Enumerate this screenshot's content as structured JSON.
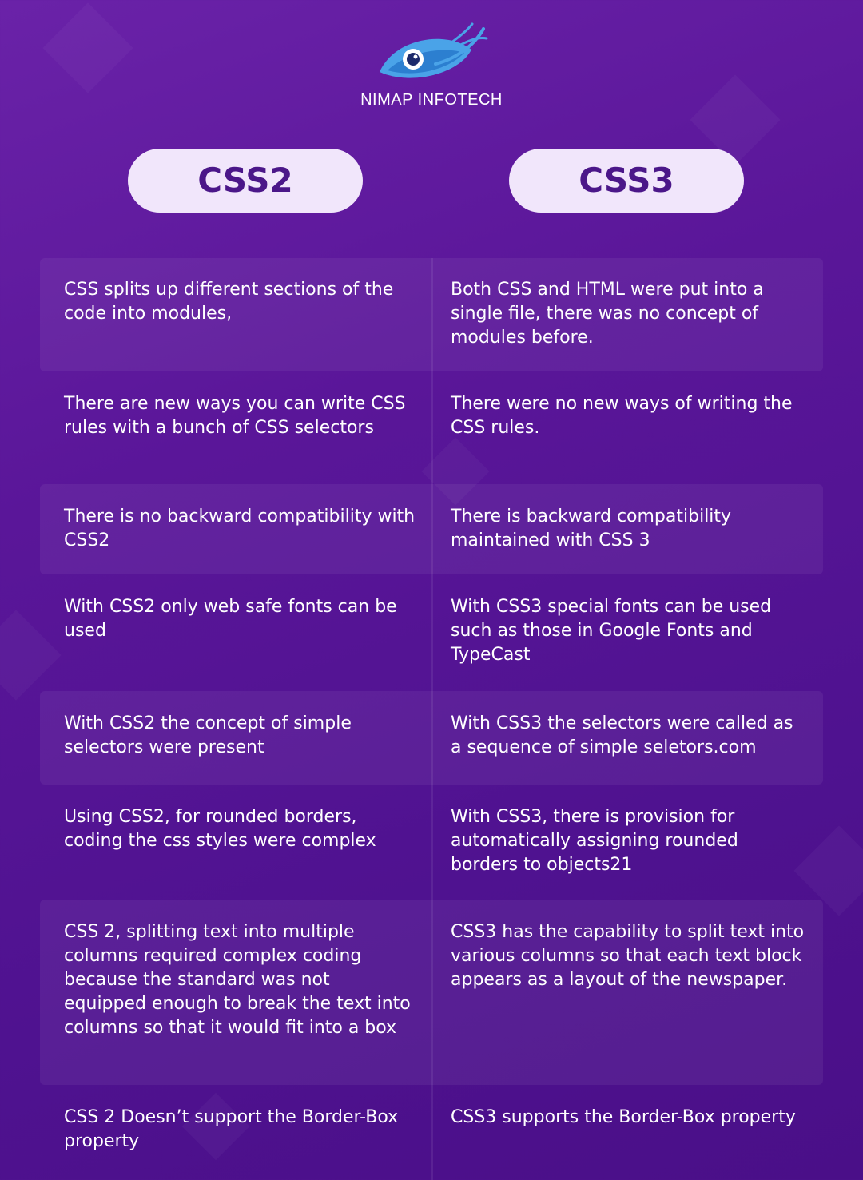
{
  "brand": {
    "name": "NIMAP INFOTECH",
    "logo_icon": "eye-logo-icon"
  },
  "headers": {
    "left": "CSS2",
    "right": "CSS3"
  },
  "colors": {
    "background": "#5a1699",
    "pill": "#f1e6fb",
    "pill_text": "#4b1789",
    "eye_blue": "#4aa3e8"
  },
  "rows": [
    {
      "left": "CSS splits up different sections of the code into modules,",
      "right": "Both CSS and HTML were put into a single file, there was no concept of modules before."
    },
    {
      "left": "There are new ways you can write CSS rules with a bunch of CSS selectors",
      "right": "There were no new ways of writing the CSS rules."
    },
    {
      "left": "There is no backward compatibility with CSS2",
      "right": "There is backward compatibility maintained with CSS 3"
    },
    {
      "left": "With CSS2 only web safe fonts can be used",
      "right": "With CSS3 special fonts can be used such as those in Google Fonts and TypeCast"
    },
    {
      "left": "With CSS2 the concept of simple selectors were present",
      "right": "With CSS3 the selectors were called as a sequence of simple seletors.com"
    },
    {
      "left": "Using CSS2, for rounded borders, coding the css styles were complex",
      "right": "With CSS3, there is provision for automatically assigning rounded borders to objects21"
    },
    {
      "left": "CSS 2, splitting text into multiple columns required complex coding because the standard was not equipped enough to break the text into columns so that it would fit into a box",
      "right": "CSS3 has the capability to split text into various columns so that each text block appears as a layout of the newspaper."
    },
    {
      "left": "CSS 2 Doesn’t support the Border-Box property",
      "right": "CSS3 supports the Border-Box property"
    }
  ]
}
